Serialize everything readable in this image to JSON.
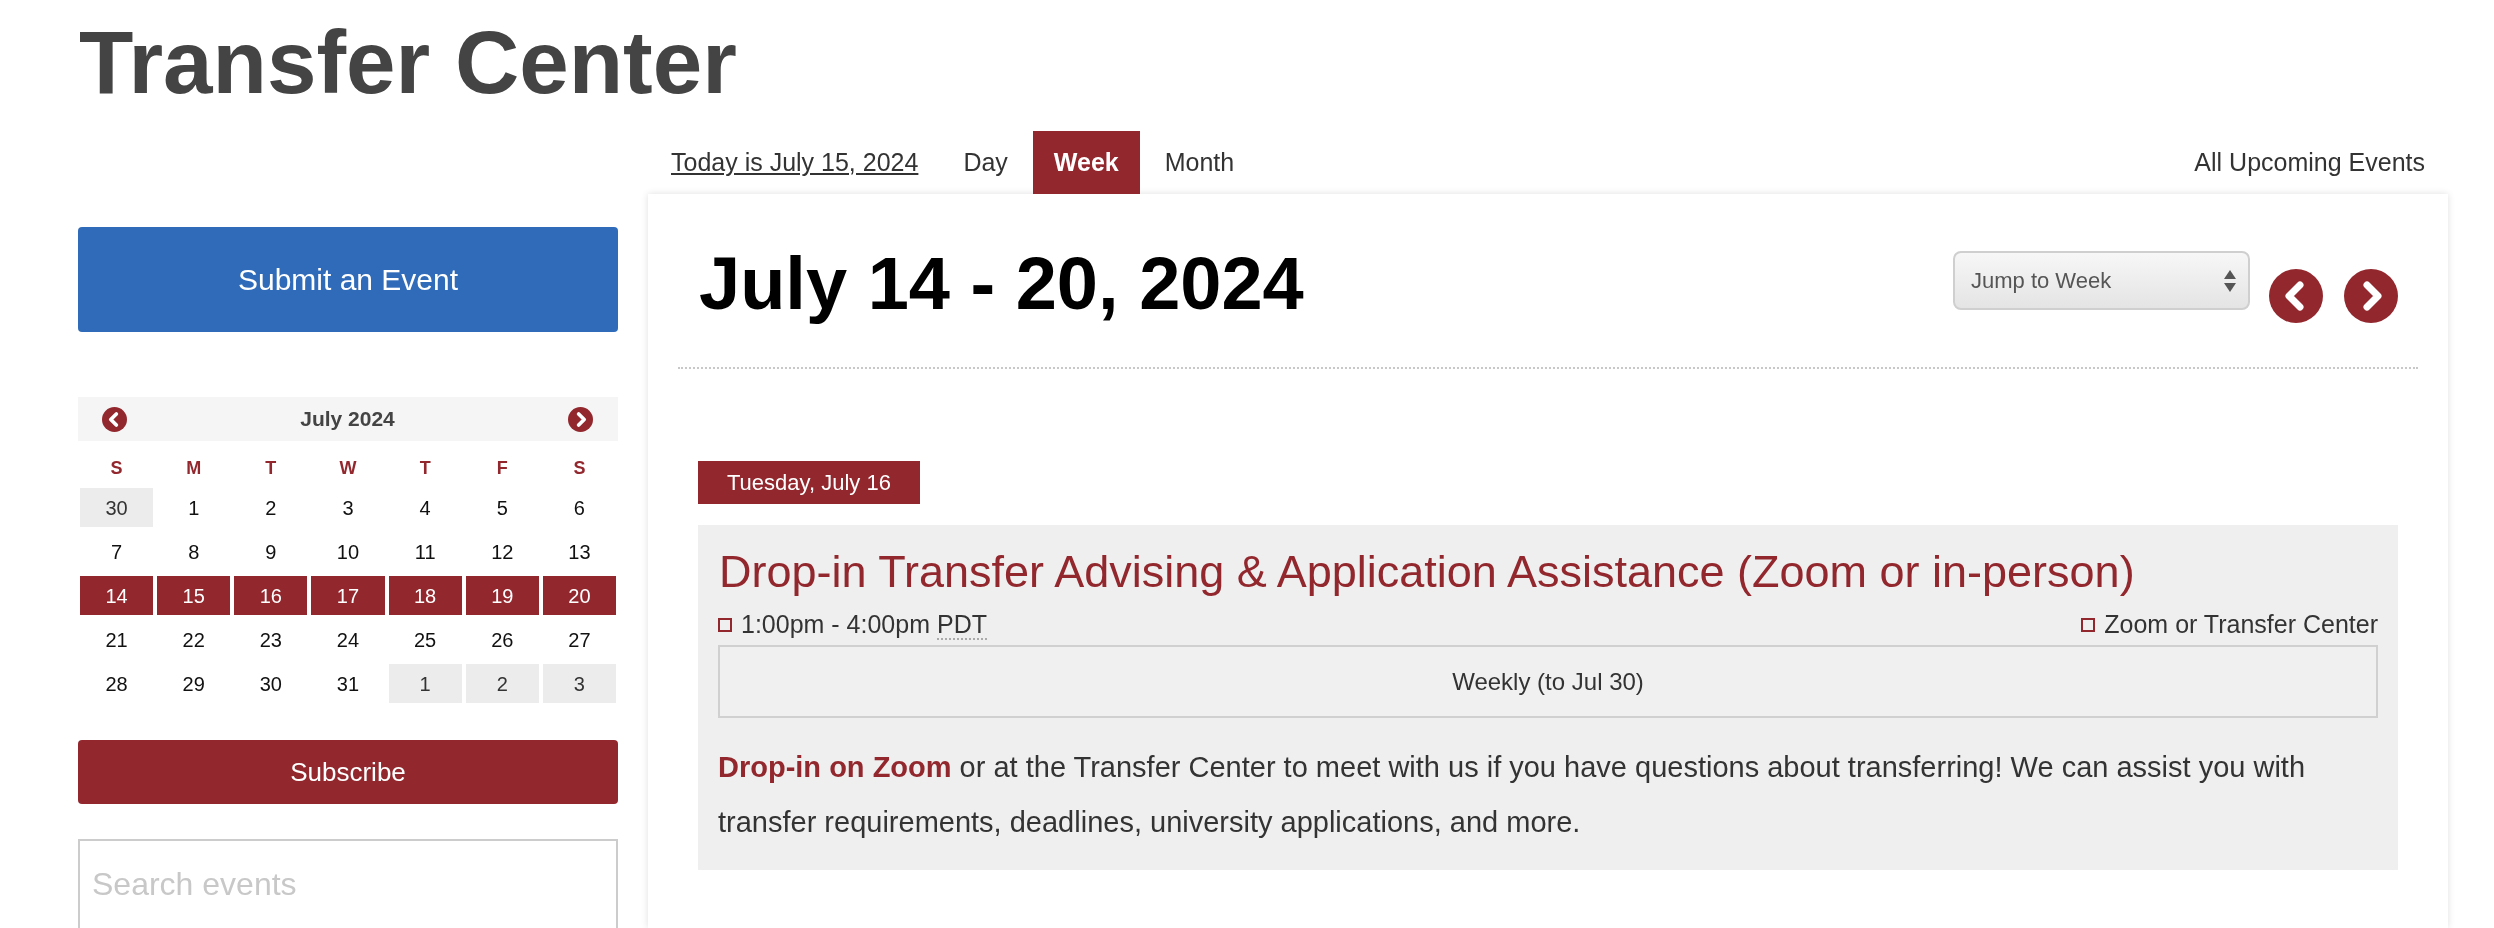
{
  "page_title": "Transfer Center",
  "submit_button": "Submit an Event",
  "mini_calendar": {
    "month": "July 2024",
    "weekdays": [
      "S",
      "M",
      "T",
      "W",
      "T",
      "F",
      "S"
    ],
    "weeks": [
      [
        {
          "day": "30",
          "selected": false,
          "other_month": true
        },
        {
          "day": "1",
          "selected": false,
          "other_month": false
        },
        {
          "day": "2",
          "selected": false,
          "other_month": false
        },
        {
          "day": "3",
          "selected": false,
          "other_month": false
        },
        {
          "day": "4",
          "selected": false,
          "other_month": false
        },
        {
          "day": "5",
          "selected": false,
          "other_month": false
        },
        {
          "day": "6",
          "selected": false,
          "other_month": false
        }
      ],
      [
        {
          "day": "7",
          "selected": false,
          "other_month": false
        },
        {
          "day": "8",
          "selected": false,
          "other_month": false
        },
        {
          "day": "9",
          "selected": false,
          "other_month": false
        },
        {
          "day": "10",
          "selected": false,
          "other_month": false
        },
        {
          "day": "11",
          "selected": false,
          "other_month": false
        },
        {
          "day": "12",
          "selected": false,
          "other_month": false
        },
        {
          "day": "13",
          "selected": false,
          "other_month": false
        }
      ],
      [
        {
          "day": "14",
          "selected": true,
          "other_month": false
        },
        {
          "day": "15",
          "selected": true,
          "other_month": false
        },
        {
          "day": "16",
          "selected": true,
          "other_month": false
        },
        {
          "day": "17",
          "selected": true,
          "other_month": false
        },
        {
          "day": "18",
          "selected": true,
          "other_month": false
        },
        {
          "day": "19",
          "selected": true,
          "other_month": false
        },
        {
          "day": "20",
          "selected": true,
          "other_month": false
        }
      ],
      [
        {
          "day": "21",
          "selected": false,
          "other_month": false
        },
        {
          "day": "22",
          "selected": false,
          "other_month": false
        },
        {
          "day": "23",
          "selected": false,
          "other_month": false
        },
        {
          "day": "24",
          "selected": false,
          "other_month": false
        },
        {
          "day": "25",
          "selected": false,
          "other_month": false
        },
        {
          "day": "26",
          "selected": false,
          "other_month": false
        },
        {
          "day": "27",
          "selected": false,
          "other_month": false
        }
      ],
      [
        {
          "day": "28",
          "selected": false,
          "other_month": false
        },
        {
          "day": "29",
          "selected": false,
          "other_month": false
        },
        {
          "day": "30",
          "selected": false,
          "other_month": false
        },
        {
          "day": "31",
          "selected": false,
          "other_month": false
        },
        {
          "day": "1",
          "selected": false,
          "other_month": true
        },
        {
          "day": "2",
          "selected": false,
          "other_month": true
        },
        {
          "day": "3",
          "selected": false,
          "other_month": true
        }
      ]
    ]
  },
  "subscribe_button": "Subscribe",
  "search": {
    "placeholder": "Search events"
  },
  "nav": {
    "today_link": "Today is July 15, 2024",
    "tabs": [
      {
        "label": "Day",
        "selected": false
      },
      {
        "label": "Week",
        "selected": true
      },
      {
        "label": "Month",
        "selected": false
      }
    ],
    "all_events_link": "All Upcoming Events"
  },
  "week_view": {
    "heading": "July 14 - 20, 2024",
    "jump_select": {
      "value": "Jump to Week"
    },
    "days": [
      {
        "date": "Tuesday, July 16",
        "events": [
          {
            "title": "Drop-in Transfer Advising & Application Assistance (Zoom or in-person)",
            "time": "1:00pm - 4:00pm",
            "timezone": "PDT",
            "location": "Zoom or Transfer Center",
            "recurrence": "Weekly (to Jul 30)",
            "description": {
              "link": "Drop-in on Zoom",
              "text": "or at the Transfer Center to meet with us if you have questions about transferring! We can assist you with transfer requirements, deadlines, university applications, and more."
            }
          }
        ]
      }
    ]
  }
}
